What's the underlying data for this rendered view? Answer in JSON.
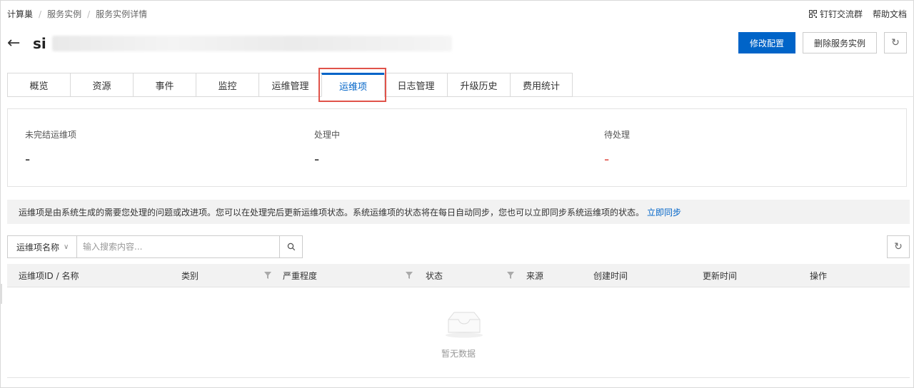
{
  "breadcrumb": [
    "计算巢",
    "服务实例",
    "服务实例详情"
  ],
  "top_links": {
    "dingtalk": "钉钉交流群",
    "help": "帮助文档"
  },
  "title": {
    "prefix": "si"
  },
  "actions": {
    "modify": "修改配置",
    "delete": "删除服务实例"
  },
  "tabs": [
    {
      "label": "概览"
    },
    {
      "label": "资源"
    },
    {
      "label": "事件"
    },
    {
      "label": "监控"
    },
    {
      "label": "运维管理"
    },
    {
      "label": "运维项",
      "active": true
    },
    {
      "label": "日志管理"
    },
    {
      "label": "升级历史"
    },
    {
      "label": "费用统计"
    }
  ],
  "stats": [
    {
      "label": "未完结运维项",
      "value": "-"
    },
    {
      "label": "处理中",
      "value": "-"
    },
    {
      "label": "待处理",
      "value": "-",
      "color": "#e0534a"
    }
  ],
  "notice": {
    "text": "运维项是由系统生成的需要您处理的问题或改进项。您可以在处理完后更新运维项状态。系统运维项的状态将在每日自动同步，您也可以立即同步系统运维项的状态。",
    "link": "立即同步"
  },
  "search": {
    "field": "运维项名称",
    "placeholder": "输入搜索内容..."
  },
  "table": {
    "columns": [
      "运维项ID / 名称",
      "类别",
      "严重程度",
      "状态",
      "来源",
      "创建时间",
      "更新时间",
      "操作"
    ],
    "empty_text": "暂无数据"
  },
  "colors": {
    "primary": "#0064c8",
    "highlight": "#e0534a"
  }
}
